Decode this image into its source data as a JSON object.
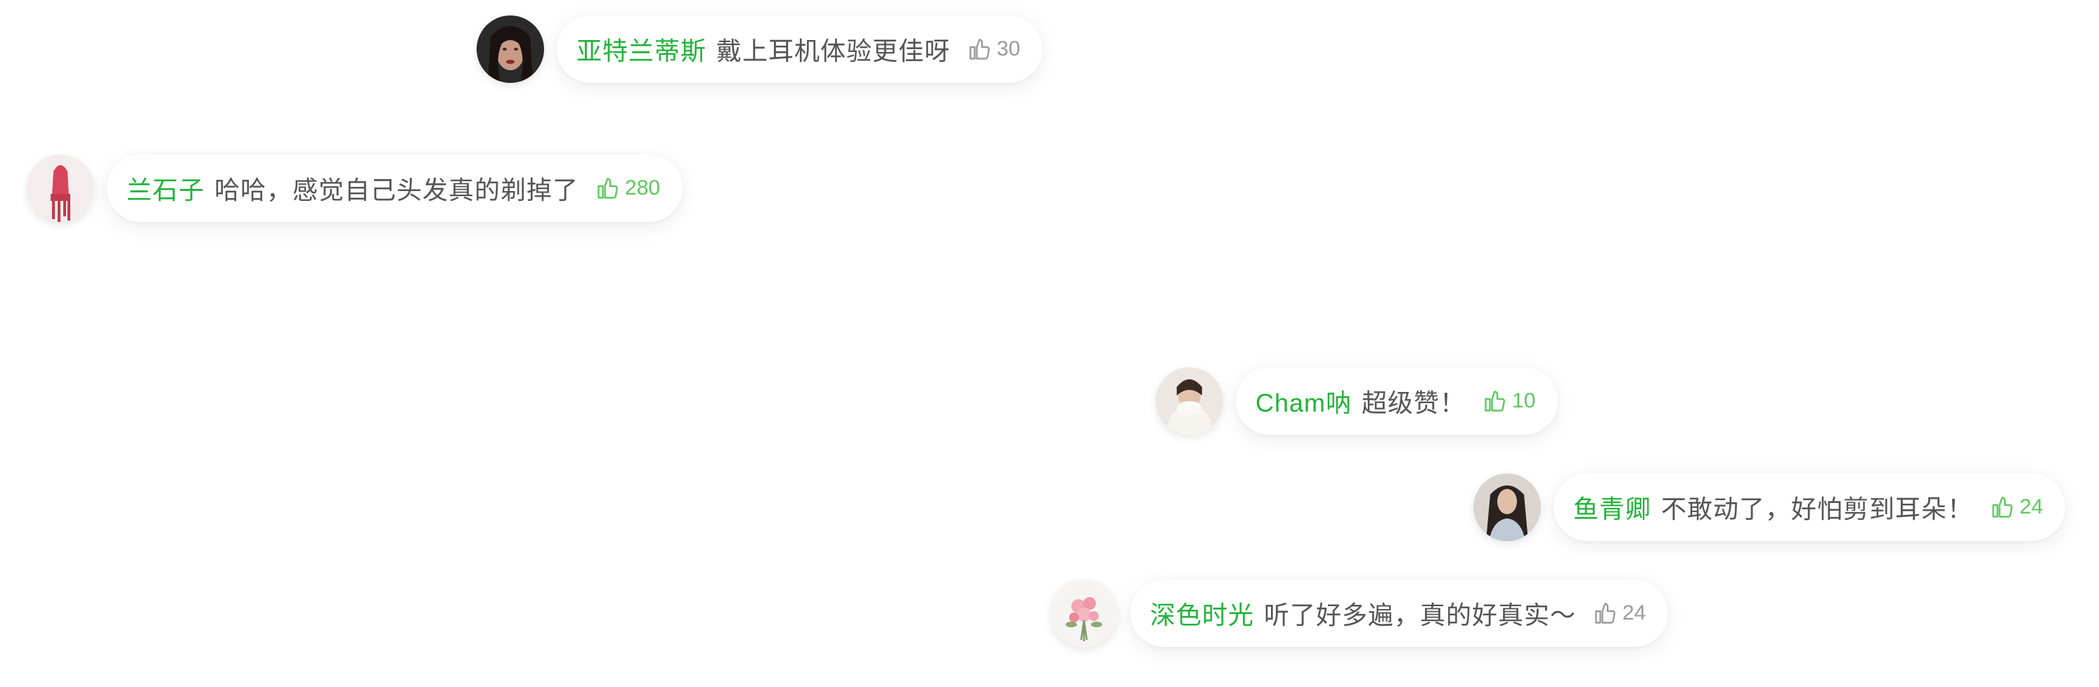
{
  "colors": {
    "name_green": "#22b33a",
    "text_grey": "#555555",
    "like_grey": "#9a9a9a",
    "like_green": "#5ec85e",
    "bubble_bg": "#ffffff"
  },
  "comments": [
    {
      "name": "亚特兰蒂斯",
      "text": "戴上耳机体验更佳呀",
      "likes": "30",
      "liked": false,
      "avatar_icon": "portrait-dark-hair-avatar"
    },
    {
      "name": "兰石子",
      "text": "哈哈，感觉自己头发真的剃掉了",
      "likes": "280",
      "liked": true,
      "avatar_icon": "red-lipstick-avatar"
    },
    {
      "name": "Cham呐",
      "text": "超级赞！",
      "likes": "10",
      "liked": true,
      "avatar_icon": "portrait-white-scarf-avatar"
    },
    {
      "name": "鱼青卿",
      "text": "不敢动了，好怕剪到耳朵！",
      "likes": "24",
      "liked": true,
      "avatar_icon": "portrait-long-hair-avatar"
    },
    {
      "name": "深色时光",
      "text": "听了好多遍，真的好真实～",
      "likes": "24",
      "liked": false,
      "avatar_icon": "pink-flower-bouquet-avatar"
    }
  ]
}
